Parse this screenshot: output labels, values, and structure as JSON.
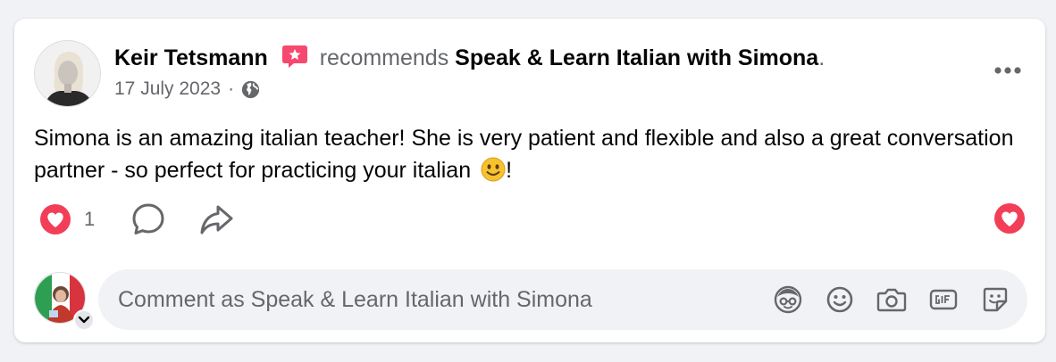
{
  "post": {
    "author": "Keir Tetsmann",
    "verb": "recommends",
    "page_name": "Speak & Learn Italian with Simona",
    "end_dot": ".",
    "date": "17 July 2023",
    "meta_separator": "·",
    "audience_icon": "globe-icon",
    "body_text": "Simona is an amazing italian teacher! She is very patient and flexible and also a great conversation partner - so perfect for practicing your italian ",
    "body_end": "!"
  },
  "actions": {
    "reaction_count": "1",
    "reaction_icon": "love-reaction-icon",
    "comment_icon": "comment-icon",
    "share_icon": "share-icon"
  },
  "comment_box": {
    "placeholder": "Comment as Speak & Learn Italian with Simona",
    "value": "",
    "tools": [
      "avatar-sticker-icon",
      "emoji-icon",
      "camera-icon",
      "gif-icon",
      "sticker-icon"
    ]
  },
  "colors": {
    "background": "#f0f2f5",
    "card": "#ffffff",
    "text_primary": "#050505",
    "text_secondary": "#65676b",
    "love_red": "#f33e58",
    "recommend_badge": "#f7486f"
  }
}
